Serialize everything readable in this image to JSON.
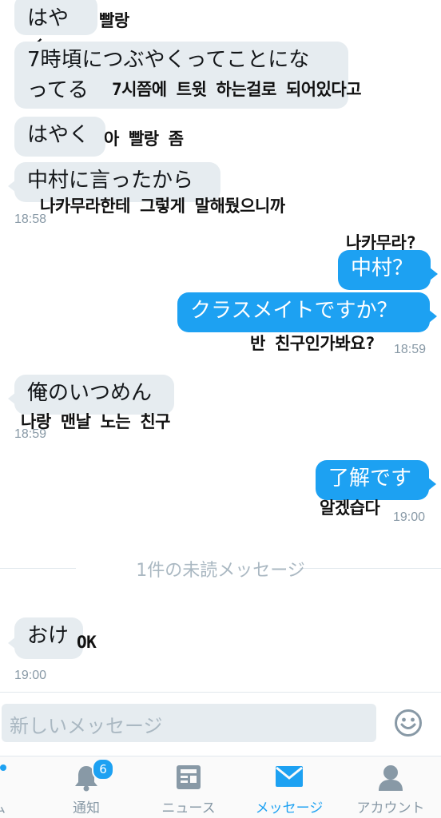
{
  "conversation": {
    "messages": [
      {
        "text": "はやく",
        "note": "빨랑"
      },
      {
        "text": "7時頃につぶやくってことになってる",
        "line1": "7時頃につぶやくってことにな",
        "line2": "ってる",
        "note": "7시쯤에 트윗 하는걸로 되어있다고"
      },
      {
        "text": "はやく",
        "note": "아 빨랑 좀"
      },
      {
        "text": "中村に言ったから",
        "note": "나카무라한테 그렇게 말해뒀으니까",
        "time": "18:58"
      },
      {
        "text": "中村？",
        "note": "나카무라?"
      },
      {
        "text": "クラスメイトですか？",
        "note": "반 친구인가봐요?",
        "time": "18:59"
      },
      {
        "text": "俺のいつめん",
        "note": "나랑 맨날 노는 친구",
        "time": "18:59"
      },
      {
        "text": "了解です",
        "note": "알겠습다",
        "time": "19:00"
      },
      {
        "text": "おけ",
        "note": "OK",
        "time": "19:00"
      }
    ],
    "unread_divider": "1件の未読メッセージ"
  },
  "composer": {
    "placeholder": "新しいメッセージ",
    "emoji_button": "emoji"
  },
  "tabbar": {
    "first_label_fragment": "ム",
    "tabs": [
      {
        "label": "通知",
        "icon": "bell-icon",
        "badge": "6"
      },
      {
        "label": "ニュース",
        "icon": "news-icon"
      },
      {
        "label": "メッセージ",
        "icon": "envelope-icon",
        "active": true
      },
      {
        "label": "アカウント",
        "icon": "person-icon"
      }
    ]
  },
  "colors": {
    "accent": "#1da1f2",
    "incoming_bubble": "#e6ecf0",
    "muted": "#8899a6"
  }
}
